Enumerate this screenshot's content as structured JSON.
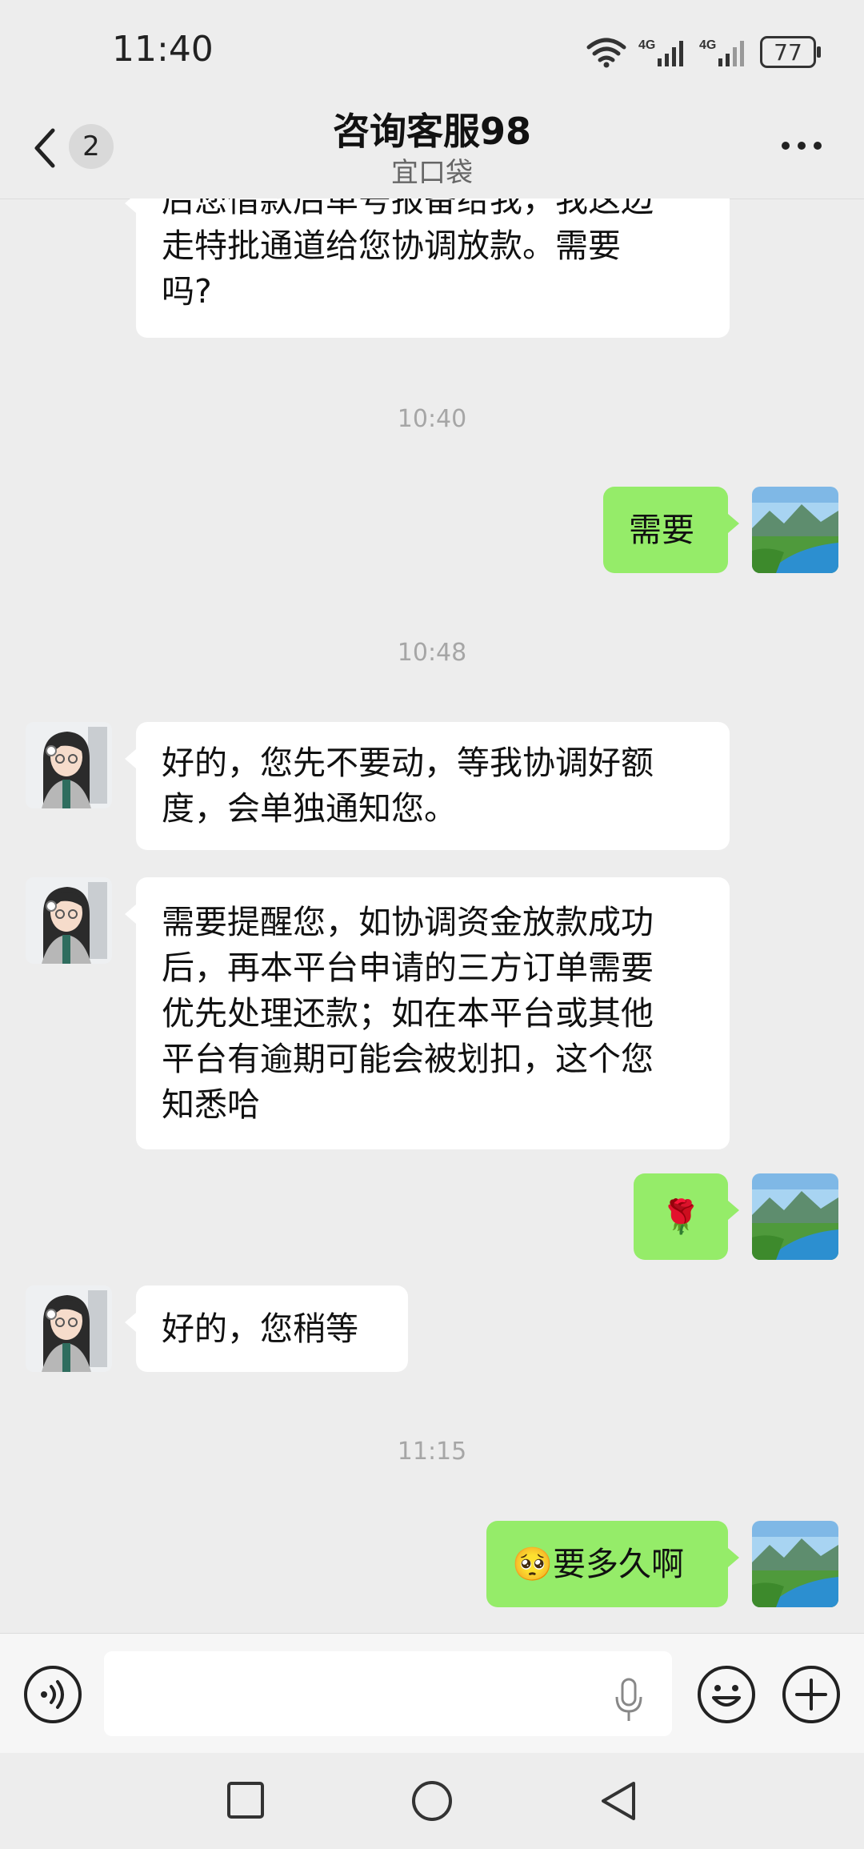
{
  "status_bar": {
    "time": "11:40",
    "battery": "77",
    "network_1": "4G",
    "network_2": "4G"
  },
  "header": {
    "unread_count": "2",
    "title": "咨询客服98",
    "subtitle": "宜口袋"
  },
  "messages": [
    {
      "type": "in",
      "text": "后您借款后单号报备给我，我这边\n走特批通道给您协调放款。需要\n吗?"
    },
    {
      "type": "time",
      "text": "10:40"
    },
    {
      "type": "out",
      "text": "需要"
    },
    {
      "type": "time",
      "text": "10:48"
    },
    {
      "type": "in",
      "text": "好的，您先不要动，等我协调好额\n度，会单独通知您。"
    },
    {
      "type": "in",
      "text": "需要提醒您，如协调资金放款成功\n后，再本平台申请的三方订单需要\n优先处理还款；如在本平台或其他\n平台有逾期可能会被划扣，这个您\n知悉哈"
    },
    {
      "type": "out",
      "text": "🌹"
    },
    {
      "type": "in",
      "text": "好的，您稍等"
    },
    {
      "type": "time",
      "text": "11:15"
    },
    {
      "type": "out",
      "text": "🥺要多久啊"
    }
  ],
  "icons": {
    "back": "chevron-left-icon",
    "more": "more-dots-icon",
    "voice": "voice-icon",
    "mic": "mic-icon",
    "emoji": "emoji-icon",
    "plus": "plus-icon"
  },
  "colors": {
    "background": "#ededed",
    "outgoing_bubble": "#95ec69",
    "incoming_bubble": "#ffffff"
  }
}
